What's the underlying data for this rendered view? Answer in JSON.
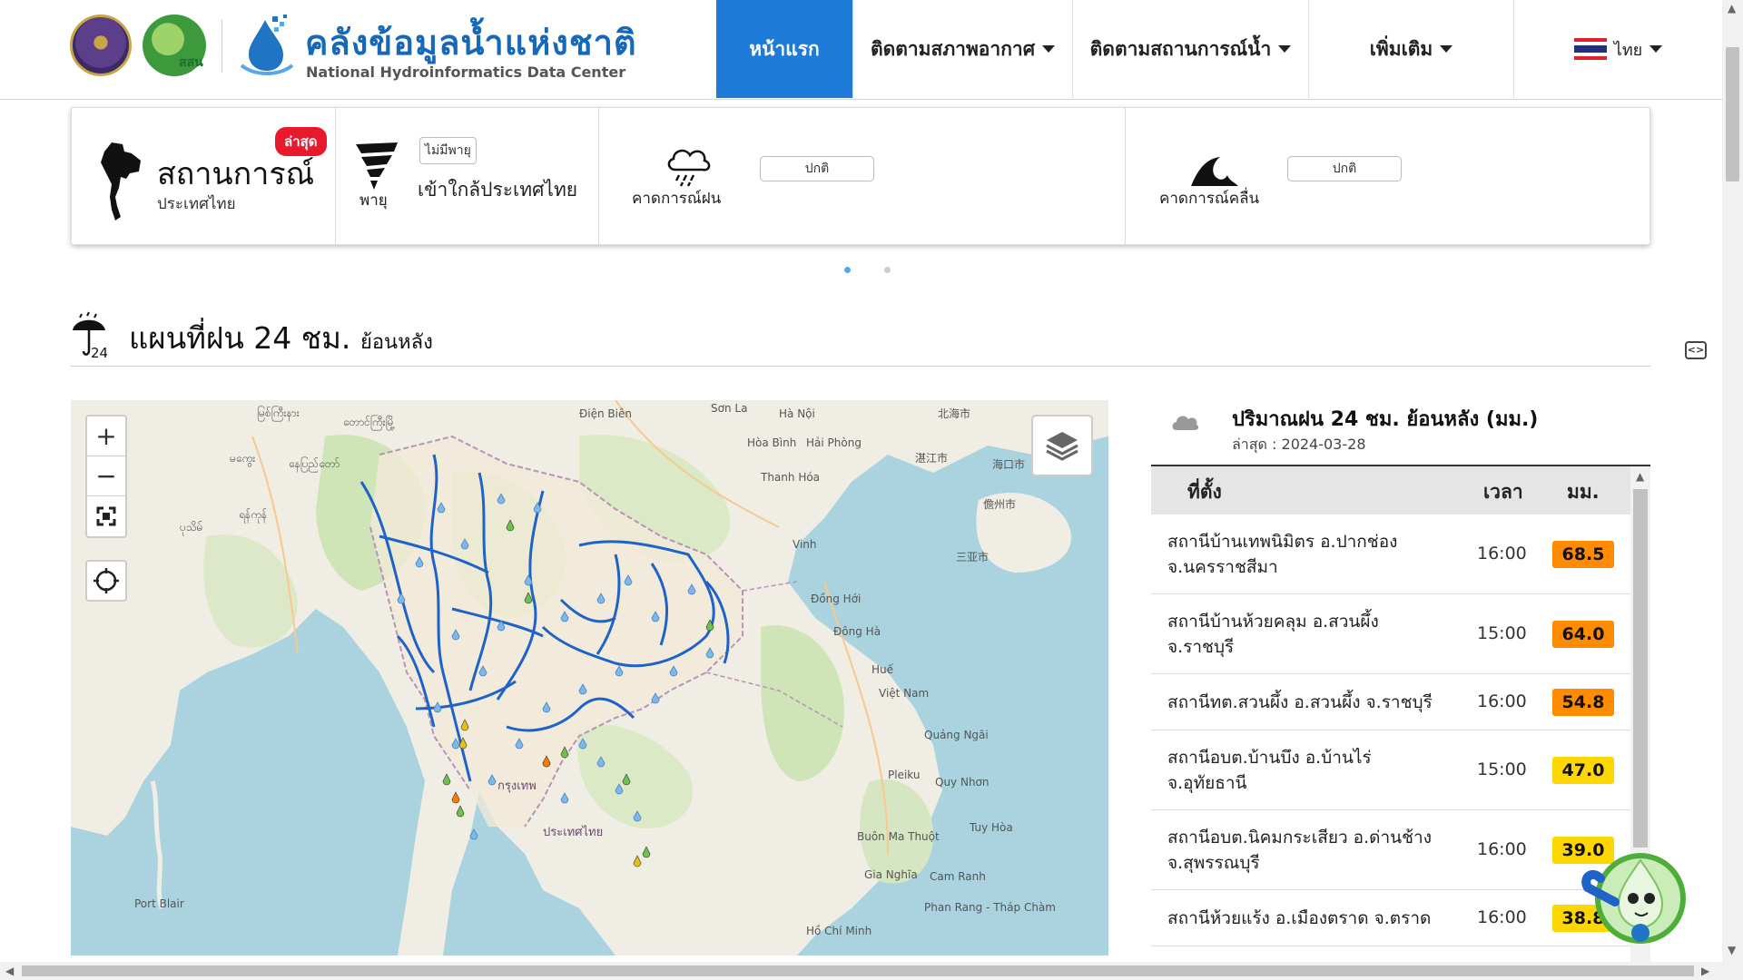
{
  "header": {
    "brand_th": "คลังข้อมูลน้ำแห่งชาติ",
    "brand_en": "National Hydroinformatics Data Center",
    "logo2_text": "สสน",
    "nav": [
      {
        "label": "หน้าแรก",
        "active": true,
        "dropdown": false
      },
      {
        "label": "ติดตามสภาพอากาศ",
        "active": false,
        "dropdown": true
      },
      {
        "label": "ติดตามสถานการณ์น้ำ",
        "active": false,
        "dropdown": true
      },
      {
        "label": "เพิ่มเติม",
        "active": false,
        "dropdown": true
      }
    ],
    "lang": "ไทย"
  },
  "status": {
    "badge": "ล่าสุด",
    "title": "สถานการณ์",
    "subtitle": "ประเทศไทย",
    "storm_label": "พายุ",
    "storm_badge": "ไม่มีพายุ",
    "storm_text": "เข้าใกล้ประเทศไทย",
    "rain_forecast_label": "คาดการณ์ฝน",
    "rain_forecast_status": "ปกติ",
    "wave_forecast_label": "คาดการณ์คลื่น",
    "wave_forecast_status": "ปกติ"
  },
  "section": {
    "icon_label": "24",
    "title": "แผนที่ฝน 24 ชม.",
    "title_suffix": "ย้อนหลัง"
  },
  "map": {
    "zoom_in": "+",
    "zoom_out": "−",
    "labels": [
      {
        "text": "မြစ်ကြီးနား",
        "l": 205,
        "t": 6
      },
      {
        "text": "တောင်ကြီးမြို့",
        "l": 300,
        "t": 16
      },
      {
        "text": "မကွေး",
        "l": 175,
        "t": 56
      },
      {
        "text": "နေပြည်တော်",
        "l": 240,
        "t": 62
      },
      {
        "text": "ပုသိမ်",
        "l": 120,
        "t": 132
      },
      {
        "text": "ရန်ကုန်",
        "l": 185,
        "t": 118
      },
      {
        "text": "Điện Biên",
        "l": 560,
        "t": 8
      },
      {
        "text": "Sơn La",
        "l": 705,
        "t": 2
      },
      {
        "text": "Hà Nội",
        "l": 780,
        "t": 8
      },
      {
        "text": "Hòa Bình",
        "l": 745,
        "t": 40
      },
      {
        "text": "Hải Phòng",
        "l": 810,
        "t": 40
      },
      {
        "text": "Thanh Hóa",
        "l": 760,
        "t": 78
      },
      {
        "text": "Vinh",
        "l": 795,
        "t": 152
      },
      {
        "text": "北海市",
        "l": 955,
        "t": 6
      },
      {
        "text": "湛江市",
        "l": 930,
        "t": 55
      },
      {
        "text": "海口市",
        "l": 1015,
        "t": 62
      },
      {
        "text": "儋州市",
        "l": 1005,
        "t": 106
      },
      {
        "text": "三亚市",
        "l": 975,
        "t": 164
      },
      {
        "text": "Đồng Hới",
        "l": 815,
        "t": 212
      },
      {
        "text": "Đông Hà",
        "l": 840,
        "t": 248
      },
      {
        "text": "Huế",
        "l": 882,
        "t": 290
      },
      {
        "text": "Việt Nam",
        "l": 890,
        "t": 316
      },
      {
        "text": "Quảng Ngãi",
        "l": 940,
        "t": 362
      },
      {
        "text": "Pleiku",
        "l": 900,
        "t": 406
      },
      {
        "text": "Quy Nhơn",
        "l": 952,
        "t": 414
      },
      {
        "text": "Buôn Ma Thuột",
        "l": 866,
        "t": 474
      },
      {
        "text": "Tuy Hòa",
        "l": 990,
        "t": 464
      },
      {
        "text": "Gia Nghĩa",
        "l": 874,
        "t": 516
      },
      {
        "text": "Cam Ranh",
        "l": 946,
        "t": 518
      },
      {
        "text": "Hồ Chí Minh",
        "l": 810,
        "t": 578
      },
      {
        "text": "Phan Rang - Tháp Chàm",
        "l": 940,
        "t": 552
      },
      {
        "text": "Port Blair",
        "l": 70,
        "t": 548
      },
      {
        "text": "ประเทศไทย",
        "l": 520,
        "t": 465
      },
      {
        "text": "กรุงเทพ",
        "l": 470,
        "t": 414
      }
    ]
  },
  "rain_panel": {
    "title": "ปริมาณฝน 24 ชม. ย้อนหลัง (มม.)",
    "updated": "ล่าสุด : 2024-03-28",
    "col_location": "ที่ตั้ง",
    "col_time": "เวลา",
    "col_mm": "มม.",
    "rows": [
      {
        "station": "สถานีบ้านเทพนิมิตร อ.ปากช่อง จ.นครราชสีมา",
        "time": "16:00",
        "value": "68.5",
        "color": "#ff8c00"
      },
      {
        "station": "สถานีบ้านห้วยคลุม อ.สวนผึ้ง จ.ราชบุรี",
        "time": "15:00",
        "value": "64.0",
        "color": "#ff8c00"
      },
      {
        "station": "สถานีทต.สวนผึ้ง อ.สวนผึ้ง จ.ราชบุรี",
        "time": "16:00",
        "value": "54.8",
        "color": "#ff8c00"
      },
      {
        "station": "สถานีอบต.บ้านบึง อ.บ้านไร่ จ.อุทัยธานี",
        "time": "15:00",
        "value": "47.0",
        "color": "#ffd700"
      },
      {
        "station": "สถานีอบต.นิคมกระเสียว อ.ด่านช้าง จ.สุพรรณบุรี",
        "time": "16:00",
        "value": "39.0",
        "color": "#ffd700"
      },
      {
        "station": "สถานีห้วยแร้ง อ.เมืองตราด จ.ตราด",
        "time": "16:00",
        "value": "38.8",
        "color": "#ffd700"
      }
    ]
  }
}
